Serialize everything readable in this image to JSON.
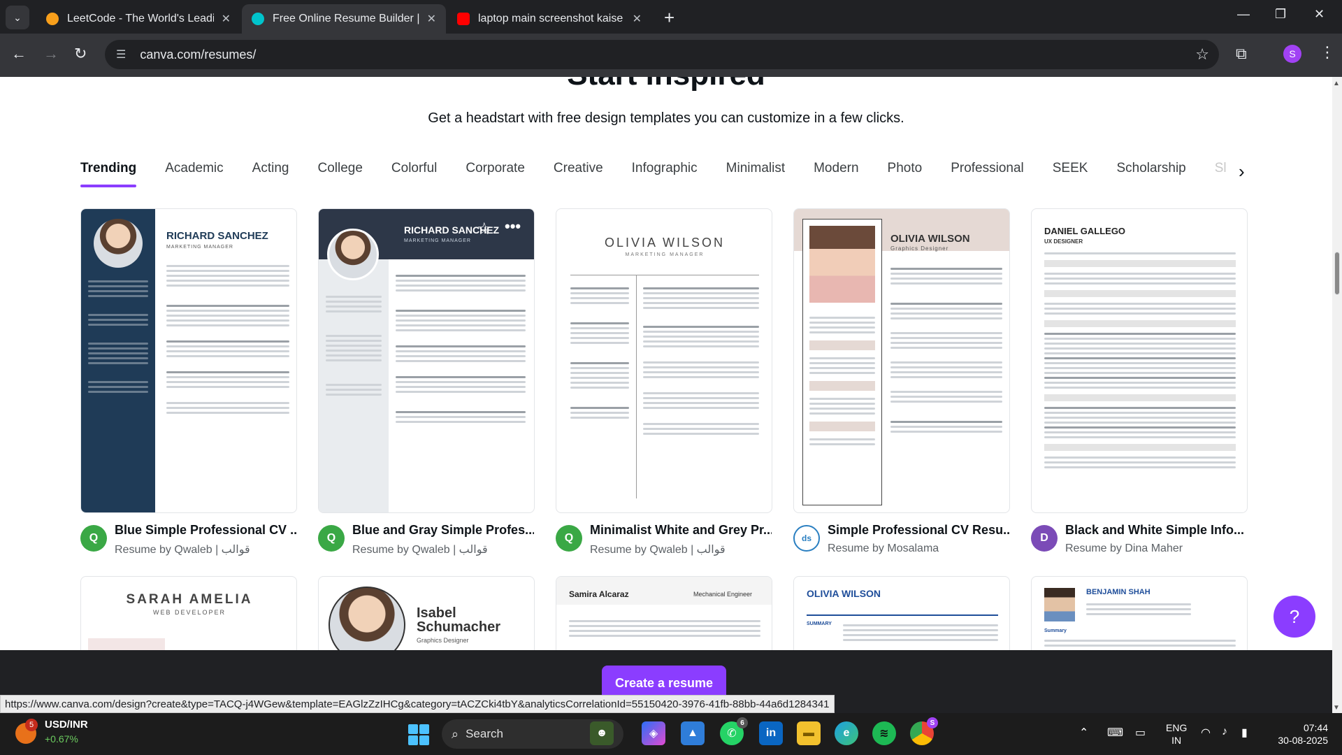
{
  "browser": {
    "tabs": [
      {
        "title": "LeetCode - The World's Leading",
        "favicon_color": "#f89f1b"
      },
      {
        "title": "Free Online Resume Builder | Ea",
        "favicon_color": "#00c4cc"
      },
      {
        "title": "laptop main screenshot kaise le",
        "favicon_color": "#ff0000"
      }
    ],
    "url": "canva.com/resumes/",
    "profile_initial": "S"
  },
  "page": {
    "heading": "Start inspired",
    "subheading": "Get a headstart with free design templates you can customize in a few clicks.",
    "categories": [
      "Trending",
      "Academic",
      "Acting",
      "College",
      "Colorful",
      "Corporate",
      "Creative",
      "Infographic",
      "Minimalist",
      "Modern",
      "Photo",
      "Professional",
      "SEEK",
      "Scholarship",
      "Sl"
    ],
    "active_category": "Trending",
    "accent_color": "#8b3dff",
    "templates": [
      {
        "title": "Blue Simple Professional CV ...",
        "by": "Resume by Qwaleb | قوالب",
        "name": "RICHARD SANCHEZ",
        "role": "MARKETING MANAGER"
      },
      {
        "title": "Blue and Gray Simple Profes...",
        "by": "Resume by Qwaleb | قوالب",
        "name": "RICHARD SANCHEZ",
        "role": "MARKETING MANAGER"
      },
      {
        "title": "Minimalist White and Grey Pr...",
        "by": "Resume by Qwaleb | قوالب",
        "name": "OLIVIA WILSON",
        "role": "MARKETING MANAGER"
      },
      {
        "title": "Simple Professional CV Resu...",
        "by": "Resume by Mosalama",
        "name": "OLIVIA WILSON",
        "role": "Graphics Designer"
      },
      {
        "title": "Black and White Simple Info...",
        "by": "Resume by Dina Maher",
        "name": "DANIEL GALLEGO",
        "role": "UX DESIGNER"
      }
    ],
    "row2": [
      {
        "name": "SARAH AMELIA",
        "role": "WEB DEVELOPER"
      },
      {
        "name": "Isabel Schumacher",
        "role": "Graphics Designer"
      },
      {
        "name": "Samira Alcaraz",
        "role": "Mechanical Engineer"
      },
      {
        "name": "OLIVIA WILSON",
        "role": "SUMMARY"
      },
      {
        "name": "BENJAMIN SHAH",
        "role": "Summary"
      }
    ],
    "cta": "Create a resume",
    "help": "?",
    "status_url": "https://www.canva.com/design?create&type=TACQ-j4WGew&template=EAGlzZzIHCg&category=tACZCki4tbY&analyticsCorrelationId=55150420-3976-41fb-88bb-44a6d1284341"
  },
  "taskbar": {
    "stock_name": "USD/INR",
    "stock_change": "+0.67%",
    "stock_badge": "5",
    "search": "Search",
    "whatsapp_badge": "6",
    "chrome_badge": "S",
    "lang_top": "ENG",
    "lang_bottom": "IN",
    "time": "07:44",
    "date": "30-08-2025"
  }
}
